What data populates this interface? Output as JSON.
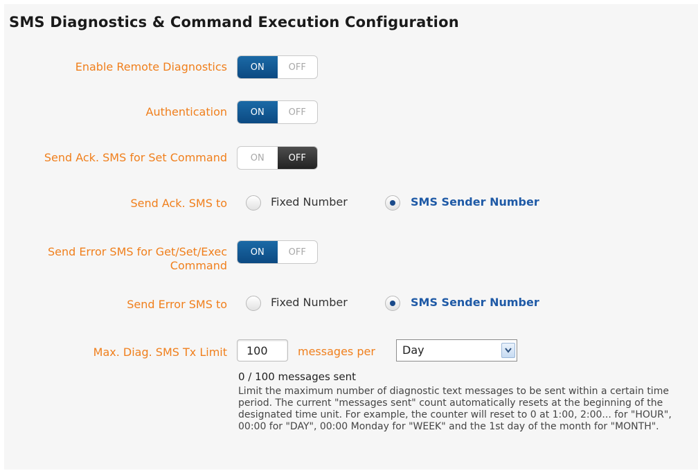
{
  "page": {
    "title": "SMS Diagnostics & Command Execution Configuration"
  },
  "rows": {
    "enable_remote_diagnostics": {
      "label": "Enable Remote Diagnostics",
      "on": "ON",
      "off": "OFF",
      "state": "ON"
    },
    "authentication": {
      "label": "Authentication",
      "on": "ON",
      "off": "OFF",
      "state": "ON"
    },
    "send_ack_set": {
      "label": "Send Ack. SMS for Set Command",
      "on": "ON",
      "off": "OFF",
      "state": "OFF"
    },
    "send_ack_to": {
      "label": "Send Ack. SMS to",
      "option1": "Fixed Number",
      "option2": "SMS Sender Number",
      "selected": "SMS Sender Number"
    },
    "send_error": {
      "label_line1": "Send Error SMS for Get/Set/Exec",
      "label_line2": "Command",
      "on": "ON",
      "off": "OFF",
      "state": "ON"
    },
    "send_error_to": {
      "label": "Send Error SMS to",
      "option1": "Fixed Number",
      "option2": "SMS Sender Number",
      "selected": "SMS Sender Number"
    },
    "max_limit": {
      "label": "Max. Diag. SMS Tx Limit",
      "value": "100",
      "messages_per": "messages per",
      "period": "Day",
      "sent": "0 / 100 messages sent",
      "help": "Limit the maximum number of diagnostic text messages to be sent within a certain time period. The current \"messages sent\" count automatically resets at the beginning of the designated time unit. For example, the counter will reset to 0 at 1:00, 2:00... for \"HOUR\", 00:00 for \"DAY\", 00:00 Monday for \"WEEK\" and the 1st day of the month for \"MONTH\"."
    }
  },
  "colors": {
    "label": "#f07f1c",
    "toggle_on": "#0c4a82",
    "toggle_off": "#222222",
    "selected_text": "#1f5aa6"
  }
}
